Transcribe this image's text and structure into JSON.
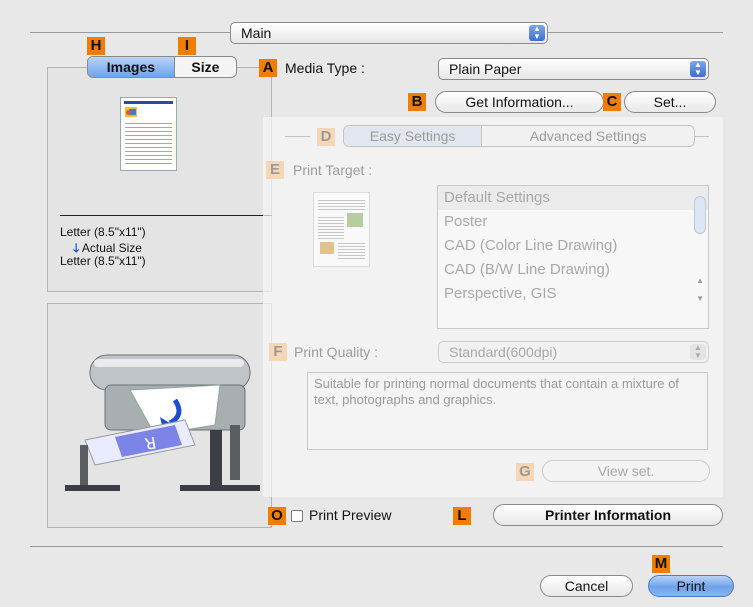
{
  "main_popup": {
    "label": "Main"
  },
  "callouts": {
    "h": "H",
    "i": "I",
    "a": "A",
    "b": "B",
    "c": "C",
    "d": "D",
    "e": "E",
    "f": "F",
    "g": "G",
    "o": "O",
    "l": "L",
    "m": "M"
  },
  "preview_tabs": {
    "images": "Images",
    "size": "Size"
  },
  "size_info": {
    "input_size": "Letter (8.5\"x11\")",
    "scaling": "Actual Size",
    "output_size": "Letter (8.5\"x11\")"
  },
  "media_type": {
    "label": "Media Type :",
    "value": "Plain Paper"
  },
  "buttons": {
    "get_information": "Get Information...",
    "set": "Set...",
    "view_set": "View set.",
    "printer_information": "Printer Information",
    "cancel": "Cancel",
    "print": "Print"
  },
  "settings_tabs": {
    "easy": "Easy Settings",
    "advanced": "Advanced Settings"
  },
  "print_target": {
    "label": "Print Target :",
    "items": [
      "Default Settings",
      "Poster",
      "CAD (Color Line Drawing)",
      "CAD (B/W Line Drawing)",
      "Perspective, GIS"
    ]
  },
  "print_quality": {
    "label": "Print Quality :",
    "value": "Standard(600dpi)",
    "description": "Suitable for printing normal documents that contain a mixture of text, photographs and graphics."
  },
  "print_preview": {
    "label": "Print Preview",
    "checked": false
  },
  "colors": {
    "callout": "#f07d00",
    "accent_blue": "#6ea2ec"
  }
}
